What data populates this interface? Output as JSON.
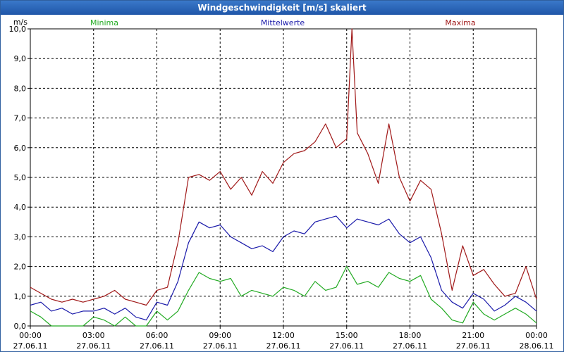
{
  "window": {
    "title": "Windgeschwindigkeit [m/s] skaliert"
  },
  "chart_data": {
    "type": "line",
    "title": "Windgeschwindigkeit [m/s] skaliert",
    "ylabel": "m/s",
    "xlabel": "",
    "ylim": [
      0,
      10
    ],
    "xlim": [
      0,
      24
    ],
    "grid": true,
    "legend_placement": "top",
    "y_ticks": [
      {
        "value": 0,
        "label": "0,0"
      },
      {
        "value": 1,
        "label": "1,0"
      },
      {
        "value": 2,
        "label": "2,0"
      },
      {
        "value": 3,
        "label": "3,0"
      },
      {
        "value": 4,
        "label": "4,0"
      },
      {
        "value": 5,
        "label": "5,0"
      },
      {
        "value": 6,
        "label": "6,0"
      },
      {
        "value": 7,
        "label": "7,0"
      },
      {
        "value": 8,
        "label": "8,0"
      },
      {
        "value": 9,
        "label": "9,0"
      },
      {
        "value": 10,
        "label": "10,0"
      }
    ],
    "x_ticks": [
      {
        "value": 0,
        "time": "00:00",
        "date": "27.06.11"
      },
      {
        "value": 3,
        "time": "03:00",
        "date": "27.06.11"
      },
      {
        "value": 6,
        "time": "06:00",
        "date": "27.06.11"
      },
      {
        "value": 9,
        "time": "09:00",
        "date": "27.06.11"
      },
      {
        "value": 12,
        "time": "12:00",
        "date": "27.06.11"
      },
      {
        "value": 15,
        "time": "15:00",
        "date": "27.06.11"
      },
      {
        "value": 18,
        "time": "18:00",
        "date": "27.06.11"
      },
      {
        "value": 21,
        "time": "21:00",
        "date": "27.06.11"
      },
      {
        "value": 24,
        "time": "00:00",
        "date": "28.06.11"
      }
    ],
    "series": [
      {
        "name": "Minima",
        "color": "#22aa22",
        "x": [
          0,
          0.5,
          1,
          1.5,
          2,
          2.5,
          3,
          3.5,
          4,
          4.5,
          5,
          5.5,
          6,
          6.5,
          7,
          7.5,
          8,
          8.5,
          9,
          9.5,
          10,
          10.5,
          11,
          11.5,
          12,
          12.5,
          13,
          13.5,
          14,
          14.5,
          15,
          15.5,
          16,
          16.5,
          17,
          17.5,
          18,
          18.5,
          19,
          19.5,
          20,
          20.5,
          21,
          21.5,
          22,
          22.5,
          23,
          23.5,
          24
        ],
        "values": [
          0.5,
          0.3,
          0,
          0,
          0,
          0,
          0.3,
          0.2,
          0,
          0.3,
          0,
          0,
          0.5,
          0.2,
          0.5,
          1.2,
          1.8,
          1.6,
          1.5,
          1.6,
          1.0,
          1.2,
          1.1,
          1.0,
          1.3,
          1.2,
          1.0,
          1.5,
          1.2,
          1.3,
          2.0,
          1.4,
          1.5,
          1.3,
          1.8,
          1.6,
          1.5,
          1.7,
          0.9,
          0.6,
          0.2,
          0.1,
          0.8,
          0.4,
          0.2,
          0.4,
          0.6,
          0.4,
          0.1
        ]
      },
      {
        "name": "Mittelwerte",
        "color": "#1a1aaa",
        "x": [
          0,
          0.5,
          1,
          1.5,
          2,
          2.5,
          3,
          3.5,
          4,
          4.5,
          5,
          5.5,
          6,
          6.5,
          7,
          7.5,
          8,
          8.5,
          9,
          9.5,
          10,
          10.5,
          11,
          11.5,
          12,
          12.5,
          13,
          13.5,
          14,
          14.5,
          15,
          15.5,
          16,
          16.5,
          17,
          17.5,
          18,
          18.5,
          19,
          19.5,
          20,
          20.5,
          21,
          21.5,
          22,
          22.5,
          23,
          23.5,
          24
        ],
        "values": [
          0.7,
          0.8,
          0.5,
          0.6,
          0.4,
          0.5,
          0.5,
          0.6,
          0.4,
          0.6,
          0.3,
          0.2,
          0.8,
          0.7,
          1.5,
          2.8,
          3.5,
          3.3,
          3.4,
          3.0,
          2.8,
          2.6,
          2.7,
          2.5,
          3.0,
          3.2,
          3.1,
          3.5,
          3.6,
          3.7,
          3.3,
          3.6,
          3.5,
          3.4,
          3.6,
          3.1,
          2.8,
          3.0,
          2.3,
          1.2,
          0.8,
          0.6,
          1.1,
          0.9,
          0.5,
          0.7,
          1.0,
          0.8,
          0.5
        ]
      },
      {
        "name": "Maxima",
        "color": "#a01818",
        "x": [
          0,
          0.5,
          1,
          1.5,
          2,
          2.5,
          3,
          3.5,
          4,
          4.5,
          5,
          5.5,
          6,
          6.5,
          7,
          7.5,
          8,
          8.5,
          9,
          9.5,
          10,
          10.5,
          11,
          11.5,
          12,
          12.5,
          13,
          13.5,
          14,
          14.5,
          15,
          15.25,
          15.5,
          16,
          16.5,
          17,
          17.5,
          18,
          18.5,
          19,
          19.5,
          20,
          20.5,
          21,
          21.5,
          22,
          22.5,
          23,
          23.5,
          24
        ],
        "values": [
          1.3,
          1.1,
          0.9,
          0.8,
          0.9,
          0.8,
          0.9,
          1.0,
          1.2,
          0.9,
          0.8,
          0.7,
          1.2,
          1.3,
          2.8,
          5.0,
          5.1,
          4.9,
          5.2,
          4.6,
          5.0,
          4.4,
          5.2,
          4.8,
          5.5,
          5.8,
          5.9,
          6.2,
          6.8,
          6.0,
          6.3,
          10.0,
          6.5,
          5.8,
          4.8,
          6.8,
          5.0,
          4.2,
          4.9,
          4.6,
          3.1,
          1.2,
          2.7,
          1.7,
          1.9,
          1.4,
          1.0,
          1.1,
          2.0,
          0.9
        ]
      }
    ]
  }
}
